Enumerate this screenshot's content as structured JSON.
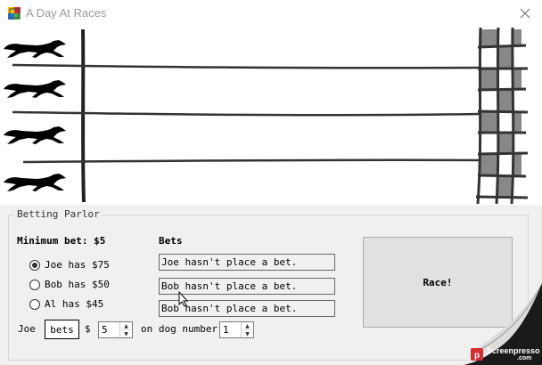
{
  "window": {
    "title": "A Day At Races",
    "icon": "app-icon",
    "close_icon": "close-icon"
  },
  "track": {
    "dogs": [
      "greyhound-icon",
      "greyhound-icon",
      "greyhound-icon",
      "greyhound-icon"
    ]
  },
  "betting_parlor": {
    "group_label": "Betting Parlor",
    "minimum_bet_label": "Minimum bet: $5",
    "bets_header": "Bets",
    "bettors": [
      {
        "label": "Joe has $75",
        "selected": true
      },
      {
        "label": "Bob has $50",
        "selected": false
      },
      {
        "label": "Al has $45",
        "selected": false
      }
    ],
    "bet_descriptions": [
      "Joe hasn't place a bet.",
      "Bob hasn't place a bet.",
      "Bob hasn't place a bet."
    ],
    "race_button": "Race!",
    "bet_row": {
      "name_label": "Joe",
      "bets_button": "bets",
      "dollar_label": "$",
      "amount_value": "5",
      "on_dog_label": "on dog number",
      "dog_number_value": "1"
    }
  },
  "watermark": {
    "text": "Screenpresso",
    "subtext": ".com"
  },
  "colors": {
    "titlebar": "#ffffff",
    "window_bg": "#f0f0f0",
    "finish_block": "#888888",
    "watermark_red": "#d32f2f"
  }
}
